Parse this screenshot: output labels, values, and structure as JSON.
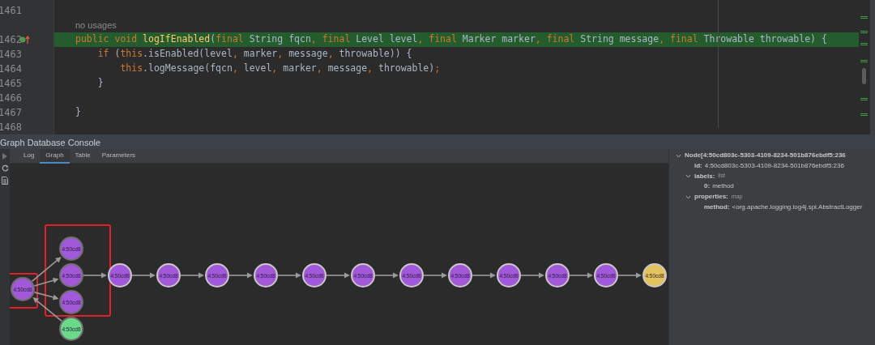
{
  "editor": {
    "rows": [
      {
        "kind": "code",
        "number": "1461",
        "highlighted": false,
        "tokens": []
      },
      {
        "kind": "hint",
        "text": "no usages"
      },
      {
        "kind": "code",
        "number": "1462",
        "highlighted": true,
        "override_mark": true,
        "tokens": [
          {
            "kind": "keyword",
            "text": "public void "
          },
          {
            "kind": "method",
            "text": "logIfEnabled"
          },
          {
            "kind": "plain",
            "text": "("
          },
          {
            "kind": "keyword",
            "text": "final"
          },
          {
            "kind": "plain",
            "text": " String fqcn"
          },
          {
            "kind": "keyword",
            "text": ", final"
          },
          {
            "kind": "plain",
            "text": " Level level"
          },
          {
            "kind": "keyword",
            "text": ", final"
          },
          {
            "kind": "plain",
            "text": " Marker marker"
          },
          {
            "kind": "keyword",
            "text": ", final"
          },
          {
            "kind": "plain",
            "text": " String message"
          },
          {
            "kind": "keyword",
            "text": ", final"
          },
          {
            "kind": "plain",
            "text": " Throwable throwable) {"
          }
        ]
      },
      {
        "kind": "code",
        "number": "1463",
        "highlighted": false,
        "tokens": [
          {
            "kind": "keyword",
            "text": "    if"
          },
          {
            "kind": "plain",
            "text": " ("
          },
          {
            "kind": "keyword",
            "text": "this"
          },
          {
            "kind": "plain",
            "text": ".isEnabled(level"
          },
          {
            "kind": "keyword",
            "text": ", "
          },
          {
            "kind": "plain",
            "text": "marker"
          },
          {
            "kind": "keyword",
            "text": ", "
          },
          {
            "kind": "plain",
            "text": "message"
          },
          {
            "kind": "keyword",
            "text": ", "
          },
          {
            "kind": "plain",
            "text": "throwable)) {"
          }
        ]
      },
      {
        "kind": "code",
        "number": "1464",
        "highlighted": false,
        "tokens": [
          {
            "kind": "keyword",
            "text": "        this"
          },
          {
            "kind": "plain",
            "text": ".logMessage(fqcn"
          },
          {
            "kind": "keyword",
            "text": ", "
          },
          {
            "kind": "plain",
            "text": "level"
          },
          {
            "kind": "keyword",
            "text": ", "
          },
          {
            "kind": "plain",
            "text": "marker"
          },
          {
            "kind": "keyword",
            "text": ", "
          },
          {
            "kind": "plain",
            "text": "message"
          },
          {
            "kind": "keyword",
            "text": ", "
          },
          {
            "kind": "plain",
            "text": "throwable)"
          },
          {
            "kind": "keyword",
            "text": ";"
          }
        ]
      },
      {
        "kind": "code",
        "number": "1465",
        "highlighted": false,
        "tokens": [
          {
            "kind": "plain",
            "text": "    }"
          }
        ]
      },
      {
        "kind": "code",
        "number": "1466",
        "highlighted": false,
        "tokens": []
      },
      {
        "kind": "code",
        "number": "1467",
        "highlighted": false,
        "tokens": [
          {
            "kind": "plain",
            "text": "}"
          }
        ]
      },
      {
        "kind": "code",
        "number": "1468",
        "highlighted": false,
        "tokens": []
      }
    ]
  },
  "console": {
    "title": "Graph Database Console",
    "tabs": [
      {
        "label": "Log",
        "selected": false
      },
      {
        "label": "Graph",
        "selected": true
      },
      {
        "label": "Table",
        "selected": false
      },
      {
        "label": "Parameters",
        "selected": false
      }
    ],
    "graph": {
      "nodes": [
        {
          "label": "4:50cd8",
          "color": "#a259d9",
          "boxed": true
        },
        {
          "label": "4:50cd8",
          "color": "#a259d9",
          "boxed": true
        },
        {
          "label": "4:50cd8",
          "color": "#a259d9",
          "boxed": true
        },
        {
          "label": "4:50cd8",
          "color": "#a259d9",
          "boxed": true
        },
        {
          "label": "4:50cd8",
          "color": "#6ad98a"
        },
        {
          "label": "4:50cd8",
          "color": "#a259d9"
        },
        {
          "label": "4:50cd8",
          "color": "#a259d9"
        },
        {
          "label": "4:50cd8",
          "color": "#a259d9"
        },
        {
          "label": "4:50cd8",
          "color": "#a259d9"
        },
        {
          "label": "4:50cd8",
          "color": "#a259d9"
        },
        {
          "label": "4:50cd8",
          "color": "#a259d9"
        },
        {
          "label": "4:50cd8",
          "color": "#a259d9"
        },
        {
          "label": "4:50cd8",
          "color": "#a259d9"
        },
        {
          "label": "4:50cd8",
          "color": "#a259d9"
        },
        {
          "label": "4:50cd8",
          "color": "#a259d9"
        },
        {
          "label": "4:50cd8",
          "color": "#a259d9"
        },
        {
          "label": "4:50cd8",
          "color": "#e3c45c"
        }
      ]
    },
    "details": [
      {
        "key": "Node[4:50cd803c-5303-4109-8234-501b876ebdf5:236",
        "expanded": true,
        "children": [
          {
            "key": "id:",
            "value": "4:50cd803c-5303-4109-8234-501b876ebdf5:236"
          },
          {
            "key": "labels:",
            "type": "list",
            "expanded": true,
            "children": [
              {
                "key": "0:",
                "value": "method"
              }
            ]
          },
          {
            "key": "properties:",
            "type": "map",
            "expanded": true,
            "children": [
              {
                "key": "method:",
                "value": "<org.apache.logging.log4j.spi.AbstractLogger"
              }
            ]
          }
        ]
      }
    ]
  }
}
